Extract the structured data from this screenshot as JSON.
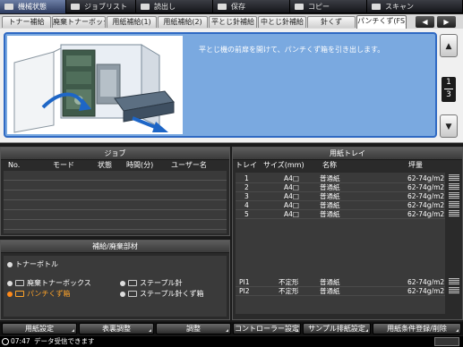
{
  "modes": [
    {
      "label": "機械状態",
      "icon": "machine-status-icon",
      "active": true
    },
    {
      "label": "ジョブリスト",
      "icon": "job-list-icon",
      "active": false
    },
    {
      "label": "読出し",
      "icon": "recall-icon",
      "active": false
    },
    {
      "label": "保存",
      "icon": "save-icon",
      "active": false
    },
    {
      "label": "コピー",
      "icon": "copy-icon",
      "active": false
    },
    {
      "label": "スキャン",
      "icon": "scan-icon",
      "active": false
    }
  ],
  "tabs": [
    {
      "label": "トナー補給",
      "active": false
    },
    {
      "label": "廃棄トナーボックス",
      "active": false
    },
    {
      "label": "用紙補給(1)",
      "active": false
    },
    {
      "label": "用紙補給(2)",
      "active": false
    },
    {
      "label": "平とじ針補給",
      "active": false
    },
    {
      "label": "中とじ針補給",
      "active": false
    },
    {
      "label": "針くず",
      "active": false
    },
    {
      "label": "パンチくず(FS)",
      "active": true
    }
  ],
  "tab_nav": {
    "prev": "◀",
    "next": "▶"
  },
  "guide": {
    "message": "平とじ機の前扉を開けて、パンチくず箱を引き出します。",
    "page_current": "1",
    "page_total": "3",
    "scroll_up": "▲",
    "scroll_down": "▼"
  },
  "job": {
    "title": "ジョブ",
    "headers": {
      "no": "No.",
      "mode": "モード",
      "status": "状態",
      "time": "時間(分)",
      "user": "ユーザー名"
    }
  },
  "supply": {
    "title": "補給/廃棄部材",
    "items": {
      "toner_bottle": "トナーボトル",
      "waste_toner_box": "廃棄トナーボックス",
      "punch_waste_box": "パンチくず箱",
      "staple": "ステープル針",
      "staple_waste": "ステープル針くず箱"
    }
  },
  "tray": {
    "title": "用紙トレイ",
    "headers": {
      "tray": "トレイ",
      "size": "サイズ(mm)",
      "name": "名称",
      "weight": "坪量"
    },
    "rows": [
      {
        "tray": "1",
        "size": "A4□",
        "name": "普通紙",
        "weight": "62-74g/m2"
      },
      {
        "tray": "2",
        "size": "A4□",
        "name": "普通紙",
        "weight": "62-74g/m2"
      },
      {
        "tray": "3",
        "size": "A4□",
        "name": "普通紙",
        "weight": "62-74g/m2"
      },
      {
        "tray": "4",
        "size": "A4□",
        "name": "普通紙",
        "weight": "62-74g/m2"
      },
      {
        "tray": "5",
        "size": "A4□",
        "name": "普通紙",
        "weight": "62-74g/m2"
      },
      {
        "tray": "PI1",
        "size": "不定形",
        "name": "普通紙",
        "weight": "62-74g/m2"
      },
      {
        "tray": "PI2",
        "size": "不定形",
        "name": "普通紙",
        "weight": "62-74g/m2"
      }
    ]
  },
  "buttons": {
    "paper_settings": "用紙設定",
    "cover_adjust": "表裏調整",
    "adjust": "調整",
    "controller_settings": "コントローラー設定",
    "sample_output": "サンプル排紙設定",
    "paper_register": "用紙条件登録/削除"
  },
  "status": {
    "time": "07:47",
    "message": "データ受信できます"
  },
  "colors": {
    "guide_bg": "#7aa9e0",
    "warning": "#ffa42a",
    "active_mode": "#2c3a5e"
  }
}
